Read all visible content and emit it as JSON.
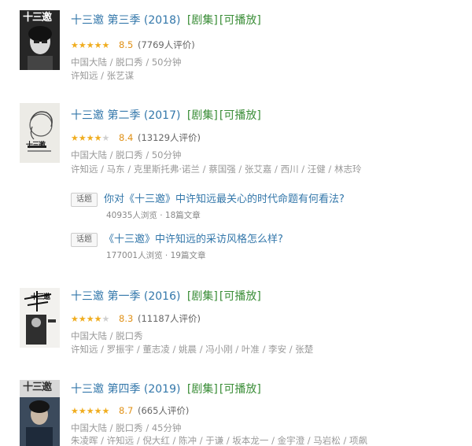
{
  "results": [
    {
      "title": "十三邀 第三季",
      "year": "(2018)",
      "tags": [
        "[剧集]",
        "[可播放]"
      ],
      "stars": "★★★★★",
      "rating": "8.5",
      "votes": "(7769人评价)",
      "meta": "中国大陆 / 脱口秀 / 50分钟",
      "cast": "许知远 / 张艺谋",
      "poster_caption": "十三邀"
    },
    {
      "title": "十三邀 第二季",
      "year": "(2017)",
      "tags": [
        "[剧集]",
        "[可播放]"
      ],
      "stars": "★★★★☆",
      "rating": "8.4",
      "votes": "(13129人评价)",
      "meta": "中国大陆 / 脱口秀 / 50分钟",
      "cast": "许知远 / 马东 / 克里斯托弗·诺兰 / 蔡国强 / 张艾嘉 / 西川 / 汪健 / 林志玲",
      "poster_caption": "十三邀"
    },
    {
      "title": "十三邀 第一季",
      "year": "(2016)",
      "tags": [
        "[剧集]",
        "[可播放]"
      ],
      "stars": "★★★★☆",
      "rating": "8.3",
      "votes": "(11187人评价)",
      "meta": "中国大陆 / 脱口秀",
      "cast": "许知远 / 罗振宇 / 董志凌 / 姚晨 / 冯小刚 / 叶准 / 李安 / 张楚",
      "poster_caption": "十三邀"
    },
    {
      "title": "十三邀 第四季",
      "year": "(2019)",
      "tags": [
        "[剧集]",
        "[可播放]"
      ],
      "stars": "★★★★★",
      "rating": "8.7",
      "votes": "(665人评价)",
      "meta": "中国大陆 / 脱口秀 / 45分钟",
      "cast": "朱凌晖 / 许知远 / 倪大红 / 陈冲 / 于谦 / 坂本龙一 / 金宇澄 / 马岩松 / 项飙",
      "poster_caption": "十三邀"
    }
  ],
  "questions": [
    {
      "tag": "话题",
      "title": "你对《十三邀》中许知远最关心的时代命题有何看法?",
      "stats": "40935人浏览 · 18篇文章"
    },
    {
      "tag": "话题",
      "title": "《十三邀》中许知远的采访风格怎么样?",
      "stats": "177001人浏览 · 19篇文章"
    }
  ],
  "colors": {
    "link": "#3377aa",
    "tag_green": "#3a8d37",
    "star": "#f0ad1f",
    "muted": "#999999"
  }
}
